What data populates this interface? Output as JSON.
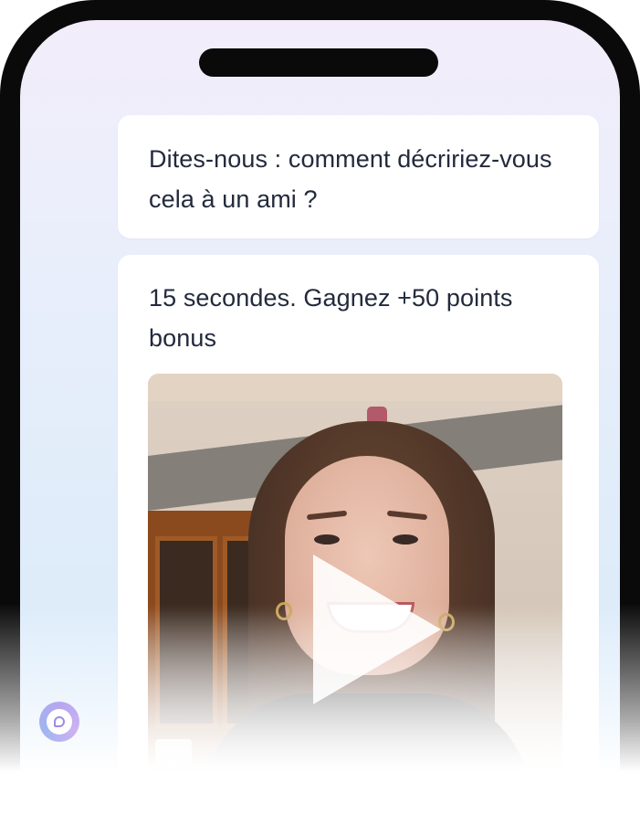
{
  "chat": {
    "question": "Dites-nous : comment décririez-vous cela à un ami ?",
    "prompt": "15 secondes. Gagnez +50 points bonus"
  },
  "video": {
    "subject": "woman smiling selfie video",
    "play_icon": "play-icon"
  },
  "chat_launcher": {
    "icon": "chat-bubble-icon",
    "accent": "#b7a6ef"
  },
  "theme": {
    "phone_frame": "#0a0a0a",
    "screen_top": "#f3edfb",
    "screen_bottom": "#d9ebfb",
    "text": "#232a3d"
  }
}
